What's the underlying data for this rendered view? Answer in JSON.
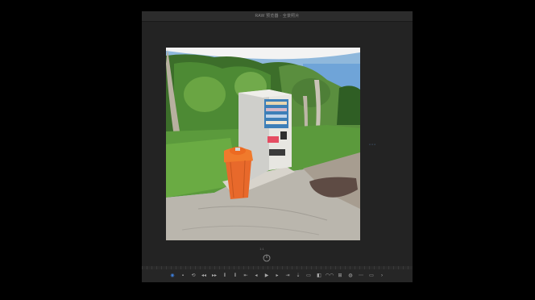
{
  "window": {
    "title": "RAW 预览器 · 全景照片"
  },
  "viewer": {
    "zoom_label": "1:1",
    "side_handle": "◦◦◦"
  },
  "photo": {
    "subject": "vending machine and orange trash bin in a park"
  },
  "transport": {
    "buttons": [
      {
        "name": "view-mode-icon",
        "glyph": "◉",
        "active": true
      },
      {
        "name": "mark-in-icon",
        "glyph": "▪"
      },
      {
        "name": "loop-icon",
        "glyph": "⟲"
      },
      {
        "name": "step-back-icon",
        "glyph": "◂◂"
      },
      {
        "name": "step-forward-icon",
        "glyph": "▸▸"
      },
      {
        "name": "in-point-icon",
        "glyph": "⦀"
      },
      {
        "name": "out-point-icon",
        "glyph": "⦀"
      },
      {
        "name": "go-to-in-icon",
        "glyph": "⇤"
      },
      {
        "name": "rewind-icon",
        "glyph": "◂"
      },
      {
        "name": "play-icon",
        "glyph": "▶"
      },
      {
        "name": "forward-icon",
        "glyph": "▸"
      },
      {
        "name": "go-to-out-icon",
        "glyph": "⇥"
      },
      {
        "name": "insert-icon",
        "glyph": "⇣"
      },
      {
        "name": "overlay-icon",
        "glyph": "▭"
      },
      {
        "name": "compare-icon",
        "glyph": "◧"
      },
      {
        "name": "vr-icon",
        "glyph": "◠◠"
      },
      {
        "name": "stereo-icon",
        "glyph": "⊞"
      },
      {
        "name": "camera-icon",
        "glyph": "◍"
      },
      {
        "name": "settings-icon",
        "glyph": "⋯"
      },
      {
        "name": "export-icon",
        "glyph": "▭"
      },
      {
        "name": "more-icon",
        "glyph": "›"
      }
    ]
  },
  "colors": {
    "background": "#000000",
    "window": "#232323",
    "accent": "#3d7dd8"
  }
}
